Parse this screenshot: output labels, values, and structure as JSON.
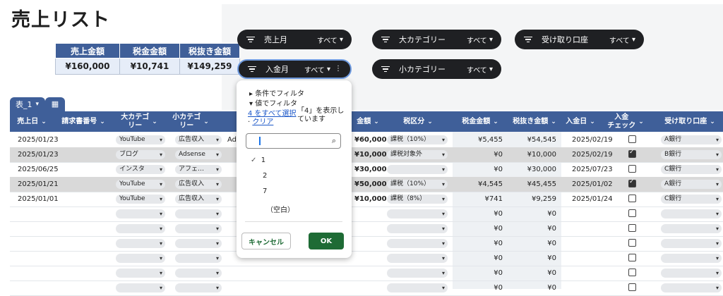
{
  "page": {
    "title": "売上リスト"
  },
  "summary": {
    "headers": [
      "売上金額",
      "税金金額",
      "税抜き金額"
    ],
    "values": [
      "¥160,000",
      "¥10,741",
      "¥149,259"
    ]
  },
  "filters": [
    {
      "label": "売上月",
      "value": "すべて"
    },
    {
      "label": "大カテゴリー",
      "value": "すべて"
    },
    {
      "label": "受け取り口座",
      "value": "すべて"
    },
    {
      "label": "入金月",
      "value": "すべて"
    },
    {
      "label": "小カテゴリー",
      "value": "すべて"
    }
  ],
  "table": {
    "tab_name": "表_1",
    "headers": [
      "売上日",
      "請求書番号",
      "大カテゴ\nリー",
      "小カテゴ\nリー",
      "金額",
      "税区分",
      "税金金額",
      "税抜き金額",
      "入金日",
      "入金\nチェック",
      "受け取り口座"
    ],
    "rows": [
      {
        "date": "2025/01/23",
        "cat1": "YouTube",
        "cat2": "広告収入",
        "name": "Ads",
        "amount": "¥60,000",
        "tax_type": "課税（10%）",
        "tax": "¥5,455",
        "net": "¥54,545",
        "paid": "2025/02/19",
        "check": false,
        "account": "A銀行"
      },
      {
        "date": "2025/01/23",
        "cat1": "ブログ",
        "cat2": "Adsense",
        "name": "",
        "amount": "¥10,000",
        "tax_type": "課税対象外",
        "tax": "¥0",
        "net": "¥10,000",
        "paid": "2025/02/19",
        "check": true,
        "account": "B銀行"
      },
      {
        "date": "2025/06/25",
        "cat1": "インスタ",
        "cat2": "アフェ…",
        "name": "",
        "amount": "¥30,000",
        "tax_type": "",
        "tax": "¥0",
        "net": "¥30,000",
        "paid": "2025/07/23",
        "check": false,
        "account": "C銀行"
      },
      {
        "date": "2025/01/21",
        "cat1": "YouTube",
        "cat2": "広告収入",
        "name": "",
        "amount": "¥50,000",
        "tax_type": "課税（10%）",
        "tax": "¥4,545",
        "net": "¥45,455",
        "paid": "2025/01/02",
        "check": true,
        "account": "A銀行"
      },
      {
        "date": "2025/01/01",
        "cat1": "YouTube",
        "cat2": "広告収入",
        "name": "",
        "amount": "¥10,000",
        "tax_type": "課税（8%）",
        "tax": "¥741",
        "net": "¥9,259",
        "paid": "2025/01/24",
        "check": false,
        "account": "C銀行"
      }
    ],
    "empty_tax": "¥0",
    "empty_net": "¥0"
  },
  "popup": {
    "filter_by_condition": "条件でフィルタ",
    "filter_by_value": "値でフィルタ",
    "select_all": "4 をすべて選択",
    "clear": "クリア",
    "showing": "「4」を表示し\nています",
    "options": [
      "1",
      "2",
      "7",
      "（空白）"
    ],
    "cancel": "キャンセル",
    "ok": "OK"
  },
  "colors": {
    "header": "#3f5f99",
    "ok_button": "#1e6b35",
    "chip": "#1f2023"
  }
}
